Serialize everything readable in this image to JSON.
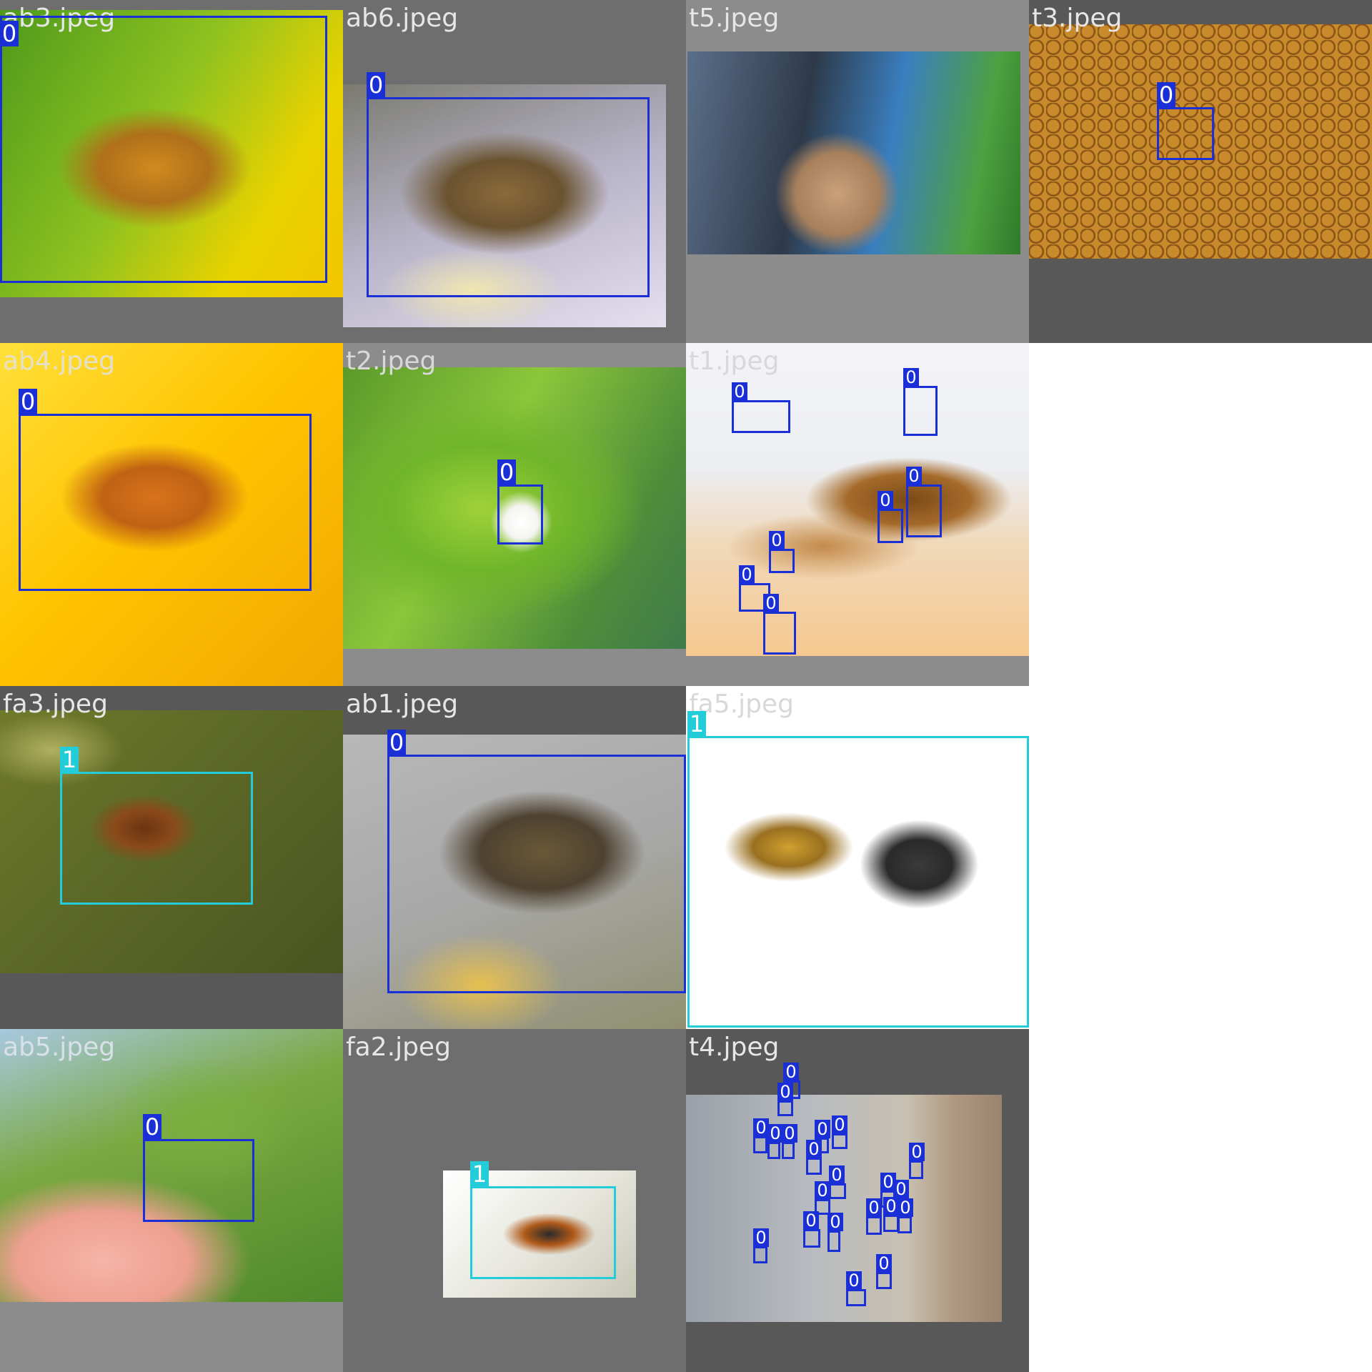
{
  "colors": {
    "class_0": "#1a2fd6",
    "class_1": "#22ccd8",
    "canvas_bg": "#ffffff"
  },
  "tiles": [
    {
      "filename": "ab3.jpeg",
      "boxes": [
        {
          "class_label": "0"
        }
      ]
    },
    {
      "filename": "ab6.jpeg",
      "boxes": [
        {
          "class_label": "0"
        }
      ]
    },
    {
      "filename": "t5.jpeg",
      "boxes": []
    },
    {
      "filename": "t3.jpeg",
      "boxes": [
        {
          "class_label": "0"
        }
      ]
    },
    {
      "filename": "ab4.jpeg",
      "boxes": [
        {
          "class_label": "0"
        }
      ]
    },
    {
      "filename": "t2.jpeg",
      "boxes": [
        {
          "class_label": "0"
        }
      ]
    },
    {
      "filename": "t1.jpeg",
      "boxes": [
        {
          "class_label": "0"
        },
        {
          "class_label": "0"
        },
        {
          "class_label": "0"
        },
        {
          "class_label": "0"
        },
        {
          "class_label": "0"
        },
        {
          "class_label": "0"
        },
        {
          "class_label": "0"
        }
      ]
    },
    {
      "filename": "fa3.jpeg",
      "boxes": [
        {
          "class_label": "1"
        }
      ]
    },
    {
      "filename": "ab1.jpeg",
      "boxes": [
        {
          "class_label": "0"
        }
      ]
    },
    {
      "filename": "fa5.jpeg",
      "boxes": [
        {
          "class_label": "1"
        }
      ]
    },
    {
      "filename": "ab5.jpeg",
      "boxes": [
        {
          "class_label": "0"
        }
      ]
    },
    {
      "filename": "fa2.jpeg",
      "boxes": [
        {
          "class_label": "1"
        }
      ]
    },
    {
      "filename": "t4.jpeg",
      "boxes": [
        {
          "class_label": "0"
        },
        {
          "class_label": "0"
        },
        {
          "class_label": "0"
        },
        {
          "class_label": "0"
        },
        {
          "class_label": "0"
        },
        {
          "class_label": "0"
        },
        {
          "class_label": "0"
        },
        {
          "class_label": "0"
        },
        {
          "class_label": "0"
        },
        {
          "class_label": "0"
        },
        {
          "class_label": "0"
        },
        {
          "class_label": "0"
        },
        {
          "class_label": "0"
        },
        {
          "class_label": "0"
        },
        {
          "class_label": "0"
        },
        {
          "class_label": "0"
        },
        {
          "class_label": "0"
        },
        {
          "class_label": "0"
        },
        {
          "class_label": "0"
        },
        {
          "class_label": "0"
        },
        {
          "class_label": "0"
        }
      ]
    }
  ]
}
